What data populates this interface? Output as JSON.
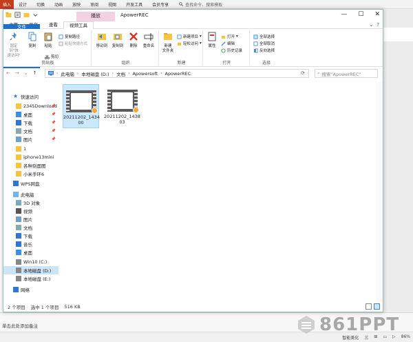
{
  "ppt": {
    "insert_tab": "插入",
    "tabs": [
      "设计",
      "切换",
      "动画",
      "放映",
      "审阅",
      "视图",
      "开发工具",
      "会员专享"
    ],
    "search": "查找命令、搜索模板",
    "notes_placeholder": "单击此处添加备注",
    "status_items": [
      "智能美化",
      "三",
      "⊞",
      "▭",
      "▷",
      "86%"
    ],
    "watermark": "861PPT"
  },
  "explorer": {
    "title": "ApowerREC",
    "context_tab": "播放",
    "tabs": [
      "文件",
      "主页",
      "共享",
      "查看",
      "视频工具"
    ],
    "ribbon": {
      "clipboard": {
        "label": "剪贴板",
        "pin_label": "固定到\"快\n速访问\"",
        "copy_label": "复制",
        "paste_label": "粘贴",
        "copy_path": "复制路径",
        "paste_shortcut": "粘贴快捷方式",
        "cut": "剪切"
      },
      "organize": {
        "label": "组织",
        "move_to": "移动到",
        "copy_to": "复制到",
        "delete": "删除",
        "rename": "重命名"
      },
      "new": {
        "label": "新建",
        "new_folder": "新建\n文件夹",
        "new_item": "新建项目",
        "easy_access": "轻松访问"
      },
      "open": {
        "label": "打开",
        "properties": "属性",
        "open": "打开",
        "edit": "编辑",
        "history": "历史记录"
      },
      "select": {
        "label": "选择",
        "select_all": "全部选择",
        "select_none": "全部取消",
        "invert": "反向选择"
      }
    },
    "address": {
      "crumbs": [
        "此电脑",
        "本地磁盘 (D:)",
        "文档",
        "Apowersoft",
        "ApowerREC"
      ],
      "search_placeholder": "搜索\"ApowerREC\""
    },
    "nav": [
      {
        "label": "快速访问",
        "icon": "star-icon",
        "pinned": false
      },
      {
        "label": "2345Download",
        "icon": "folder-icon",
        "pinned": true
      },
      {
        "label": "桌面",
        "icon": "desktop-icon",
        "pinned": true
      },
      {
        "label": "下载",
        "icon": "download-icon",
        "pinned": true
      },
      {
        "label": "文档",
        "icon": "document-icon",
        "pinned": true
      },
      {
        "label": "图片",
        "icon": "picture-icon",
        "pinned": true
      },
      {
        "label": "1",
        "icon": "folder-icon",
        "pinned": false
      },
      {
        "label": "iphone13mini",
        "icon": "folder-icon",
        "pinned": false
      },
      {
        "label": "各种刻面图",
        "icon": "folder-icon",
        "pinned": false
      },
      {
        "label": "小米手环6",
        "icon": "folder-icon",
        "pinned": false
      },
      {
        "label": "WPS网盘",
        "icon": "cloud-icon",
        "pinned": false
      },
      {
        "label": "此电脑",
        "icon": "pc-icon",
        "pinned": false
      },
      {
        "label": "3D 对象",
        "icon": "cube-icon",
        "pinned": false
      },
      {
        "label": "视频",
        "icon": "video-icon",
        "pinned": false
      },
      {
        "label": "图片",
        "icon": "picture-icon",
        "pinned": false
      },
      {
        "label": "文档",
        "icon": "document-icon",
        "pinned": false
      },
      {
        "label": "下载",
        "icon": "download-icon",
        "pinned": false
      },
      {
        "label": "音乐",
        "icon": "music-icon",
        "pinned": false
      },
      {
        "label": "桌面",
        "icon": "desktop-icon",
        "pinned": false
      },
      {
        "label": "Win10 (C:)",
        "icon": "drive-icon",
        "pinned": false
      },
      {
        "label": "本地磁盘 (D:)",
        "icon": "drive-icon",
        "pinned": false,
        "selected": true
      },
      {
        "label": "本地磁盘 (E:)",
        "icon": "drive-icon",
        "pinned": false
      },
      {
        "label": "网络",
        "icon": "network-icon",
        "pinned": false
      }
    ],
    "files": [
      {
        "name": "20211202_1434\n00",
        "selected": true
      },
      {
        "name": "20211202_1438\n03",
        "selected": false
      }
    ],
    "status": {
      "count": "2 个项目",
      "selection": "选中 1 个项目",
      "size": "516 KB"
    },
    "colors": {
      "file_tab": "#1f6fc6",
      "context_tab": "#f4d1e0",
      "selection": "#cce8ff"
    }
  }
}
